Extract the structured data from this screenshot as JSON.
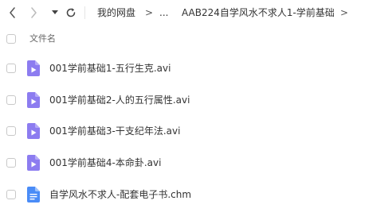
{
  "toolbar": {
    "back_icon": "chevron-left-icon",
    "forward_icon": "chevron-right-icon",
    "dropdown_icon": "caret-down-icon",
    "refresh_icon": "refresh-icon"
  },
  "breadcrumb": {
    "root": "我的网盘",
    "separator": ">",
    "ellipsis": "...",
    "current": "AAB224自学风水不求人1-学前基础"
  },
  "list": {
    "column_name": "文件名",
    "files": [
      {
        "name": "001学前基础1-五行生克.avi",
        "icon": "video-file-icon"
      },
      {
        "name": "001学前基础2-人的五行属性.avi",
        "icon": "video-file-icon"
      },
      {
        "name": "001学前基础3-干支纪年法.avi",
        "icon": "video-file-icon"
      },
      {
        "name": "001学前基础4-本命卦.avi",
        "icon": "video-file-icon"
      },
      {
        "name": "自学风水不求人-配套电子书.chm",
        "icon": "document-file-icon"
      }
    ]
  },
  "colors": {
    "video_icon": "#8c7cf0",
    "document_icon": "#4a8cf7",
    "text": "#333333",
    "checkbox_border": "#c8c8c8"
  }
}
